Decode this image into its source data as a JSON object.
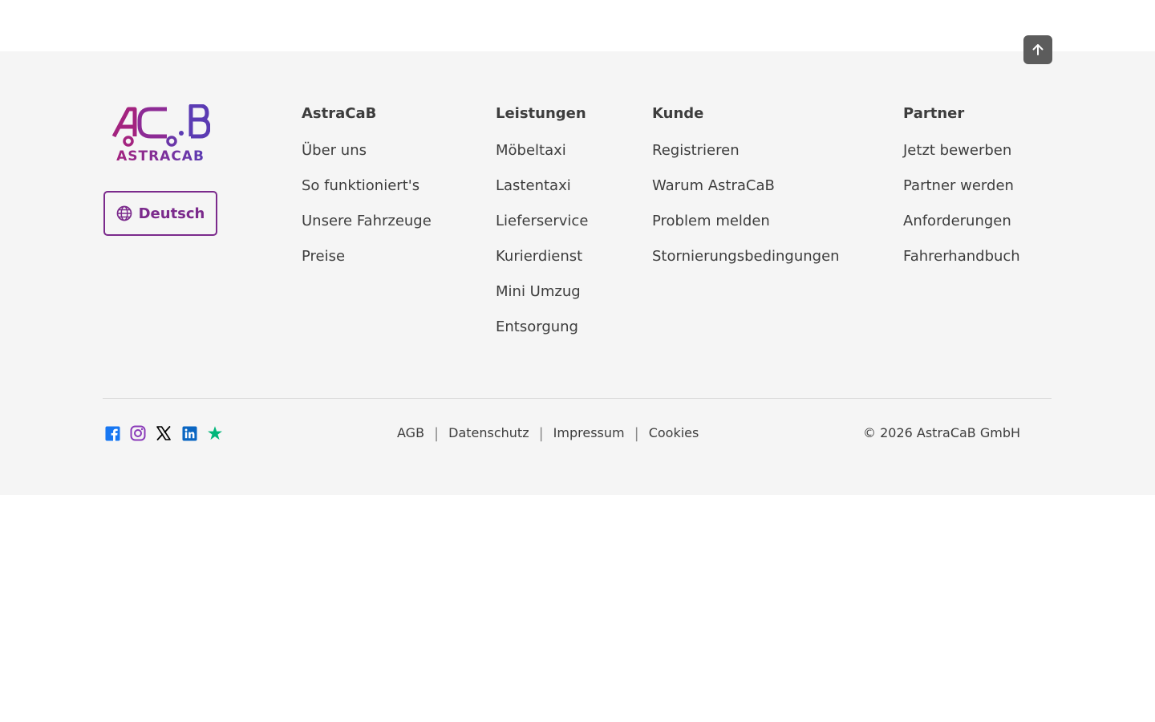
{
  "brand": {
    "logo_mark": "AC.B",
    "logo_wordmark": "ASTRACAB",
    "colors": {
      "magenta": "#a3237f",
      "violet": "#5b3bb3",
      "accent": "#7b2a8c"
    }
  },
  "language": {
    "label": "Deutsch",
    "icon": "globe-icon"
  },
  "scroll_top": {
    "icon": "arrow-up-icon"
  },
  "columns": [
    {
      "heading": "AstraCaB",
      "links": [
        "Über uns",
        "So funktioniert's",
        "Unsere Fahrzeuge",
        "Preise"
      ]
    },
    {
      "heading": "Leistungen",
      "links": [
        "Möbeltaxi",
        "Lastentaxi",
        "Lieferservice",
        "Kurierdienst",
        "Mini Umzug",
        "Entsorgung"
      ]
    },
    {
      "heading": "Kunde",
      "links": [
        "Registrieren",
        "Warum AstraCaB",
        "Problem melden",
        "Stornierungsbedingungen"
      ]
    },
    {
      "heading": "Partner",
      "links": [
        "Jetzt bewerben",
        "Partner werden",
        "Anforderungen",
        "Fahrerhandbuch"
      ]
    }
  ],
  "socials": [
    {
      "icon": "facebook-icon",
      "color": "#1877f2"
    },
    {
      "icon": "instagram-icon",
      "color": "#8a3ab9"
    },
    {
      "icon": "x-icon",
      "color": "#000000"
    },
    {
      "icon": "linkedin-icon",
      "color": "#0a66c2"
    },
    {
      "icon": "trustpilot-star-icon",
      "color": "#00b67a"
    }
  ],
  "legal_links": [
    "AGB",
    "Datenschutz",
    "Impressum",
    "Cookies"
  ],
  "legal_separator": "|",
  "copyright": "© 2026 AstraCaB GmbH"
}
